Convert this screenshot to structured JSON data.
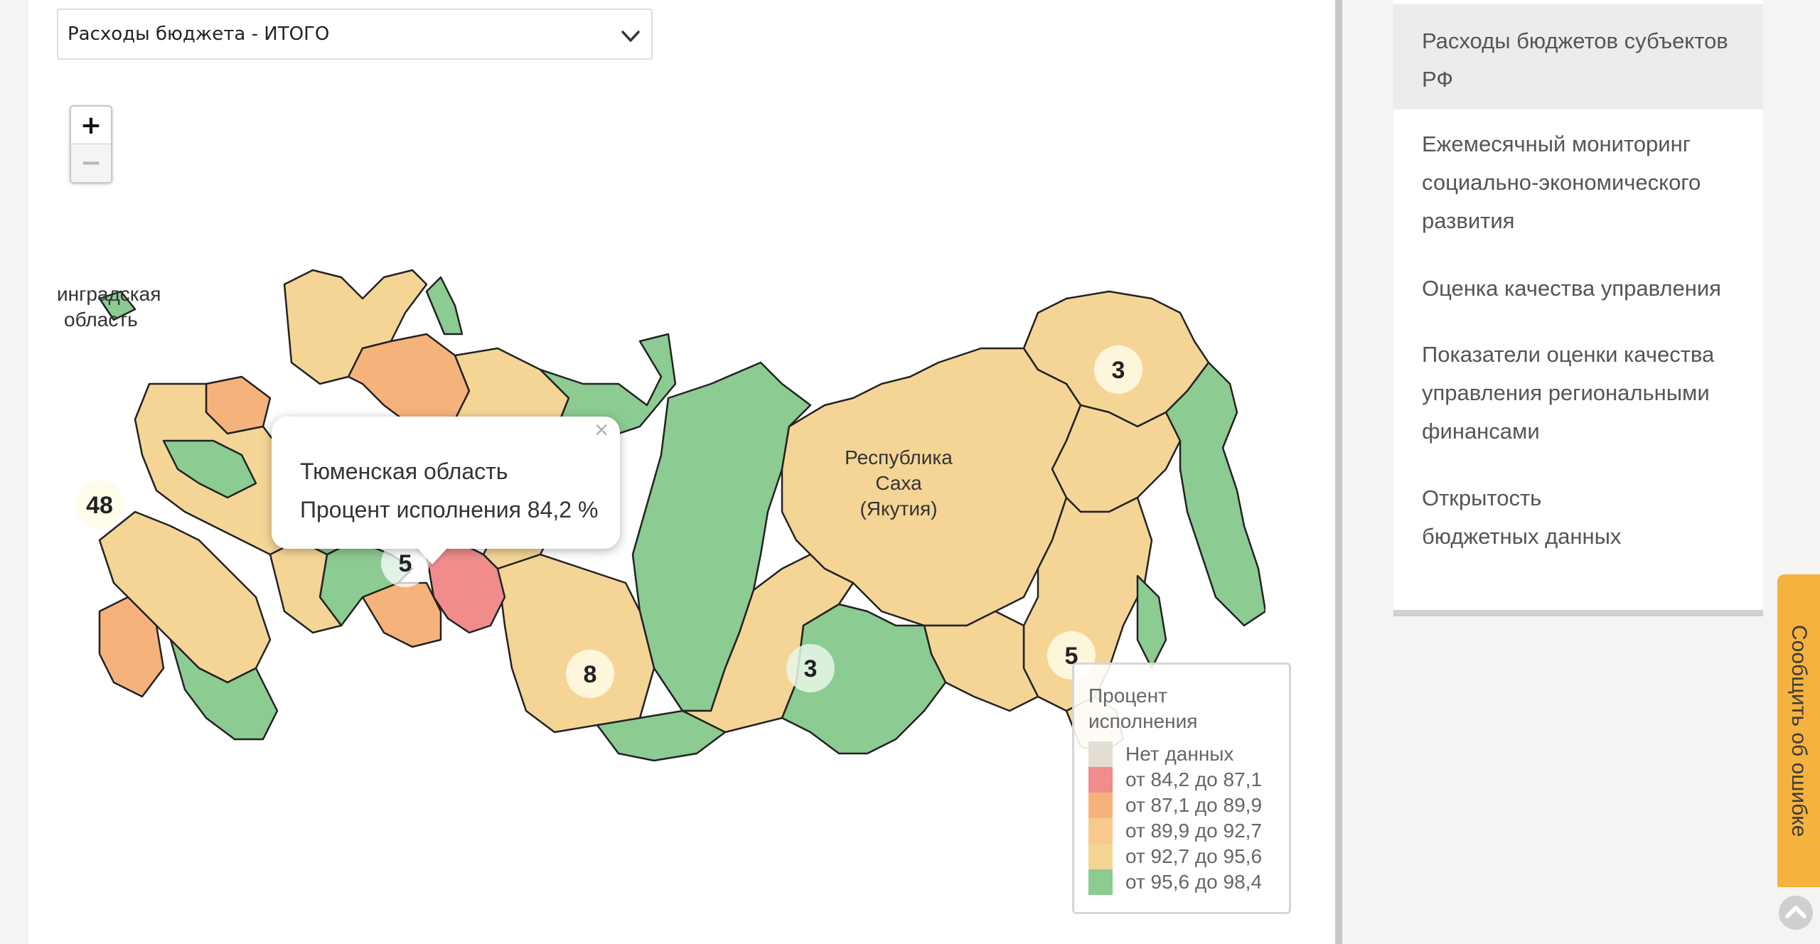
{
  "dropdown": {
    "value": "Расходы бюджета - ИТОГО",
    "icon": "chevron-down-icon"
  },
  "zoom": {
    "in_label": "+",
    "out_label": "−"
  },
  "map": {
    "labels": {
      "kaliningrad": [
        "инградская",
        "область"
      ],
      "sakha": [
        "Республика",
        "Саха",
        "(Якутия)"
      ]
    },
    "clusters": [
      {
        "id": "cluster-west",
        "count": "48"
      },
      {
        "id": "cluster-ural",
        "count": "5"
      },
      {
        "id": "cluster-siberia-south",
        "count": "8"
      },
      {
        "id": "cluster-buryatia",
        "count": "3"
      },
      {
        "id": "cluster-magadan",
        "count": "3"
      },
      {
        "id": "cluster-far-east",
        "count": "5"
      }
    ],
    "colors": {
      "no_data": "#e4ddd4",
      "bin1": "#f08c8c",
      "bin2": "#f5b37b",
      "bin3": "#f8c98d",
      "bin4": "#f5d596",
      "bin5": "#8ccb92"
    }
  },
  "popup": {
    "region": "Тюменская область",
    "value_line": "Процент исполнения 84,2 %",
    "close": "×"
  },
  "legend": {
    "title": "Процент исполнения",
    "items": [
      {
        "label": "Нет данных",
        "color": "#e4ddd4"
      },
      {
        "label": "от 84,2 до 87,1",
        "color": "#f08c8c"
      },
      {
        "label": "от 87,1 до 89,9",
        "color": "#f5b37b"
      },
      {
        "label": "от 89,9 до 92,7",
        "color": "#f8c98d"
      },
      {
        "label": "от 92,7 до 95,6",
        "color": "#f5d596"
      },
      {
        "label": "от 95,6 до 98,4",
        "color": "#8ccb92"
      }
    ]
  },
  "nav": {
    "items": [
      {
        "lines": [
          "Расходы бюджетов субъектов",
          "РФ"
        ]
      },
      {
        "lines": [
          "Ежемесячный мониторинг",
          "социально-экономического",
          "развития"
        ]
      },
      {
        "lines": [
          "Оценка качества управления"
        ]
      },
      {
        "lines": [
          "Показатели оценки качества",
          "управления региональными",
          "финансами"
        ]
      },
      {
        "lines": [
          "Открытость",
          "бюджетных данных"
        ]
      }
    ]
  },
  "report_button": "Сообщить об ошибке"
}
